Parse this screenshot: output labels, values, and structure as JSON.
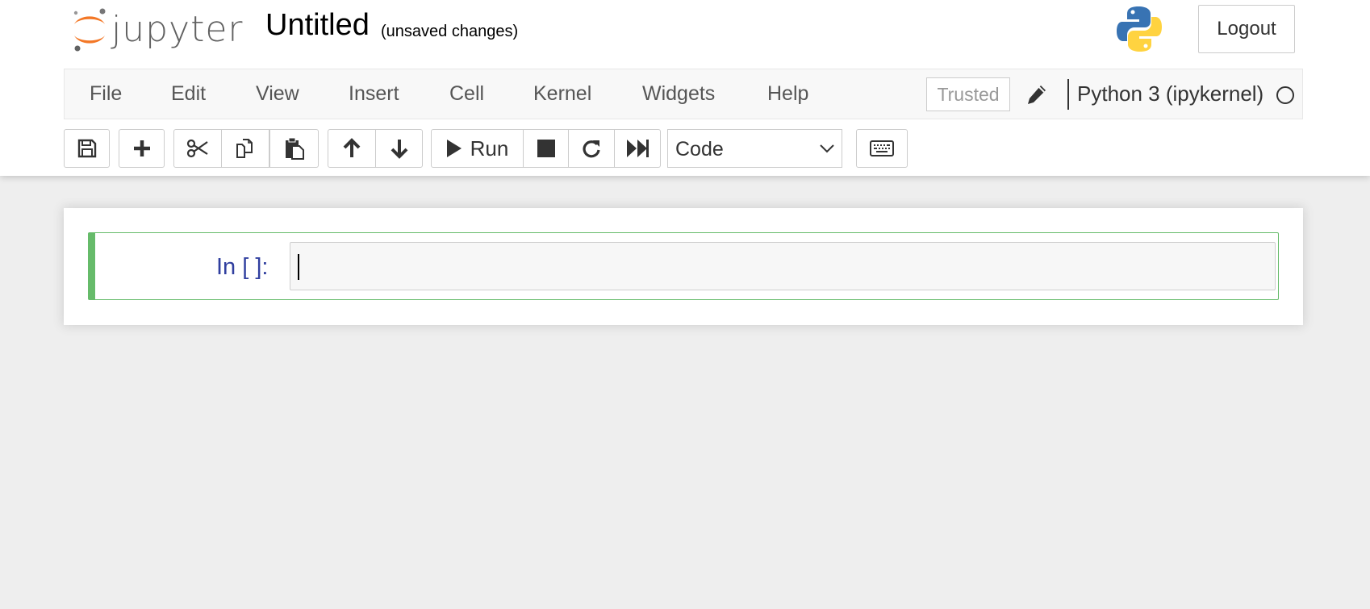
{
  "header": {
    "logo_text": "jupyter",
    "notebook_title": "Untitled",
    "save_status": "(unsaved changes)",
    "logout_label": "Logout",
    "icons": [
      "jupyter-logo",
      "python-logo"
    ]
  },
  "menubar": {
    "items": [
      "File",
      "Edit",
      "View",
      "Insert",
      "Cell",
      "Kernel",
      "Widgets",
      "Help"
    ],
    "trusted_label": "Trusted",
    "kernel_name": "Python 3 (ipykernel)",
    "kernel_status": "idle"
  },
  "toolbar": {
    "run_label": "Run",
    "cell_type": "Code",
    "cell_type_options": [
      "Code"
    ],
    "buttons": [
      "save-icon",
      "plus-icon",
      "scissors-icon",
      "copy-icon",
      "paste-icon",
      "arrow-up-icon",
      "arrow-down-icon",
      "play-icon",
      "stop-icon",
      "restart-icon",
      "fast-forward-icon",
      "keyboard-icon"
    ]
  },
  "cells": [
    {
      "prompt": "In [ ]:",
      "source": ""
    }
  ],
  "colors": {
    "jupyter_orange": "#f37726",
    "cell_selected_border": "#66bb6a",
    "prompt_blue": "#303f9f",
    "background": "#eeeeee"
  }
}
